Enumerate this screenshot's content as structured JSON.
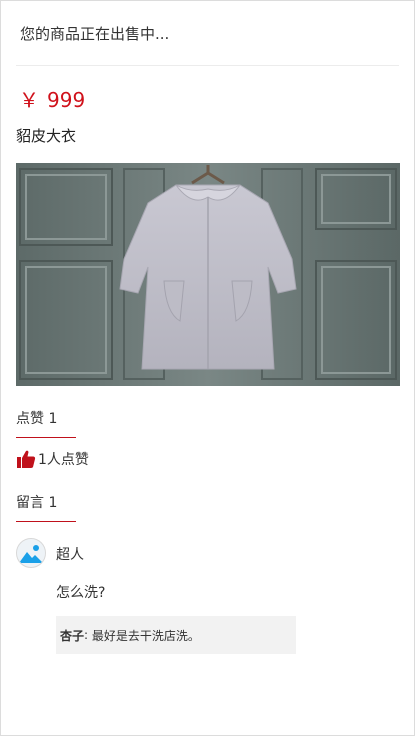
{
  "header": {
    "status_text": "您的商品正在出售中..."
  },
  "product": {
    "currency_symbol": "￥",
    "price": "999",
    "title": "貂皮大衣",
    "image_desc": "grey-mink-coat-photo"
  },
  "likes_section": {
    "heading": "点赞 1",
    "like_text": "1人点赞",
    "icon": "thumbs-up-icon",
    "icon_color": "#c0111b"
  },
  "comments_section": {
    "heading": "留言 1",
    "comments": [
      {
        "user": "超人",
        "avatar_icon": "avatar-image-icon",
        "text": "怎么洗?",
        "reply": {
          "user": "杏子",
          "separator": ":",
          "text": "最好是去干洗店洗。"
        }
      }
    ]
  },
  "colors": {
    "accent": "#d0111b",
    "divider": "#c0111b",
    "reply_bg": "#f2f2f2"
  }
}
